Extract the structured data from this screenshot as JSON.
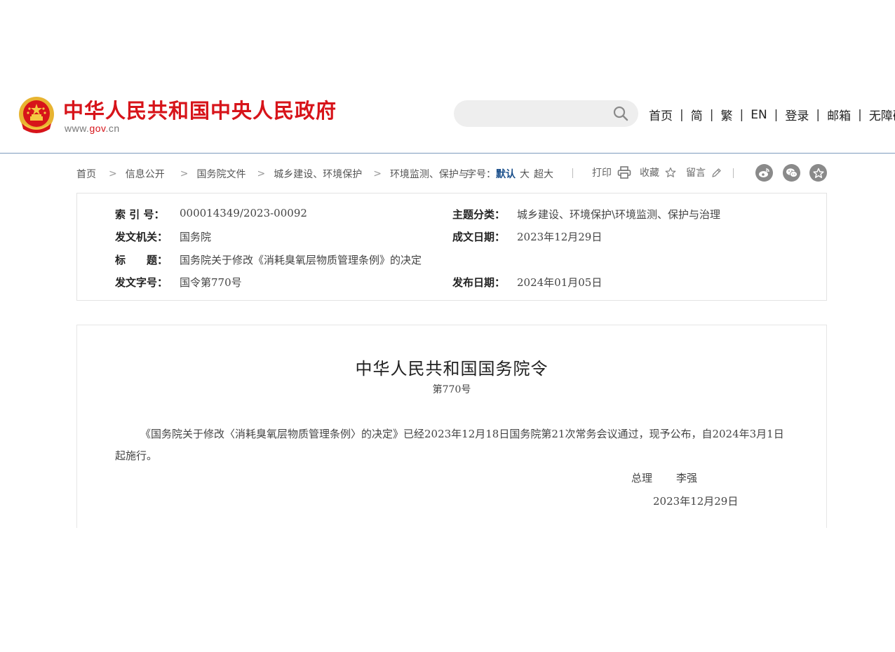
{
  "header": {
    "site_title": "中华人民共和国中央人民政府",
    "domain_prefix": "www.",
    "domain_highlight": "gov",
    "domain_suffix": ".cn",
    "search_placeholder": "",
    "search_icon": "search-icon",
    "nav": [
      "首页",
      "简",
      "繁",
      "EN",
      "登录",
      "邮箱",
      "无障碍"
    ]
  },
  "breadcrumb": [
    "首页",
    "信息公开",
    "国务院文件",
    "城乡建设、环境保护",
    "环境监测、保护与治理"
  ],
  "toolbar": {
    "font_label": "字号：",
    "font_options": [
      "默认",
      "大",
      "超大"
    ],
    "print_label": "打印",
    "favorite_label": "收藏",
    "message_label": "留言"
  },
  "info": {
    "index_label": "索 引 号：",
    "index_value": "000014349/2023-00092",
    "category_label": "主题分类：",
    "category_value": "城乡建设、环境保护\\环境监测、保护与治理",
    "issuer_label": "发文机关：",
    "issuer_value": "国务院",
    "written_label": "成文日期：",
    "written_value": "2023年12月29日",
    "title_label": "标　　题：",
    "title_value": "国务院关于修改《消耗臭氧层物质管理条例》的决定",
    "docno_label": "发文字号：",
    "docno_value": "国令第770号",
    "published_label": "发布日期：",
    "published_value": "2024年01月05日"
  },
  "article": {
    "title": "中华人民共和国国务院令",
    "number": "第770号",
    "body": "《国务院关于修改〈消耗臭氧层物质管理条例〉的决定》已经2023年12月18日国务院第21次常务会议通过，现予公布，自2024年3月1日起施行。",
    "signer_title": "总理",
    "signer_name": "李强",
    "date": "2023年12月29日"
  },
  "colors": {
    "brand_red": "#d7141a",
    "active_blue": "#1a4f8b",
    "header_line": "#7d9bbd"
  }
}
